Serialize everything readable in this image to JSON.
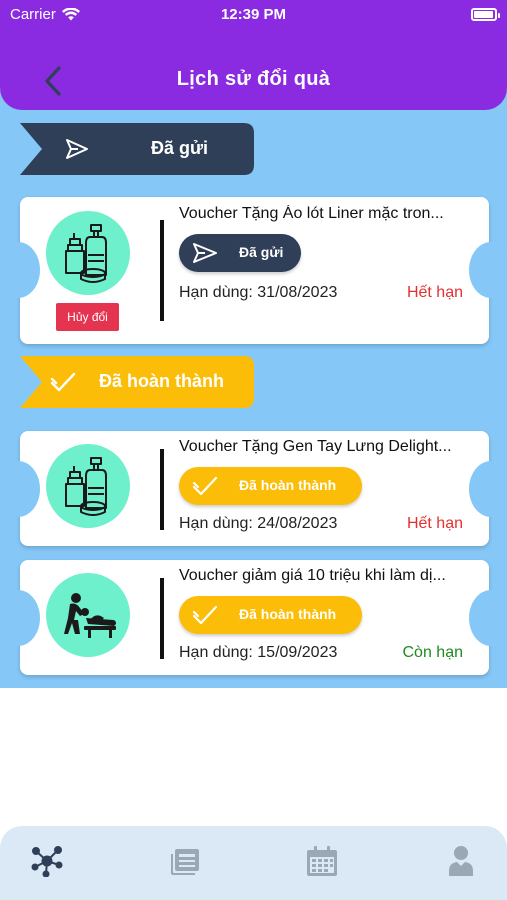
{
  "status_bar": {
    "carrier": "Carrier",
    "time": "12:39 PM",
    "battery_level": 0.95
  },
  "header": {
    "title": "Lịch sử đổi quà"
  },
  "sections": {
    "sent": {
      "label": "Đã gửi",
      "color": "#2f3f58"
    },
    "done": {
      "label": "Đã hoàn thành",
      "color": "#fbbd08"
    }
  },
  "vouchers": [
    {
      "title": "Voucher Tặng Áo lót Liner mặc tron...",
      "status_pill": "Đã gửi",
      "expiry": "Hạn dùng: 31/08/2023",
      "validity": "Hết hạn",
      "validity_color": "#e53030",
      "cancel_label": "Hủy đổi",
      "icon": "cosmetics-icon"
    },
    {
      "title": "Voucher Tặng Gen Tay Lưng Delight...",
      "status_pill": "Đã hoàn thành",
      "expiry": "Hạn dùng: 24/08/2023",
      "validity": "Hết hạn",
      "validity_color": "#e53030",
      "icon": "cosmetics-icon"
    },
    {
      "title": "Voucher giảm giá 10 triệu khi làm dị...",
      "status_pill": "Đã hoàn thành",
      "expiry": "Hạn dùng: 15/09/2023",
      "validity": "Còn hạn",
      "validity_color": "#1f8a1f",
      "icon": "spa-treatment-icon"
    }
  ],
  "tabbar": {
    "items": [
      "network-icon",
      "news-icon",
      "calendar-icon",
      "profile-icon"
    ],
    "active_index": 0,
    "active_color": "#2f3f58",
    "inactive_color": "#9aa7b4"
  }
}
